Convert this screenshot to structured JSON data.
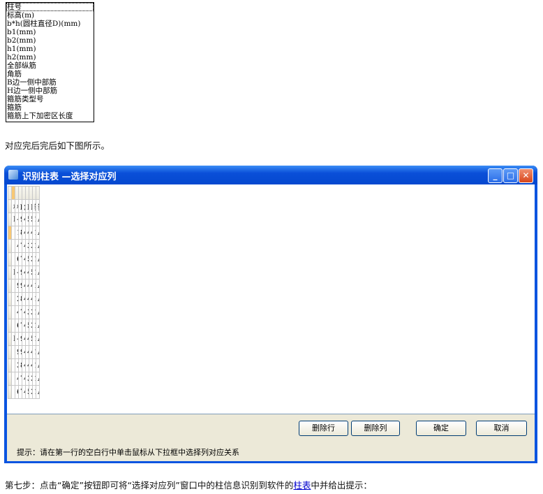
{
  "dropdown": {
    "options": [
      "柱号",
      "标高(m)",
      "b*h(圆柱直径D)(mm)",
      "b1(mm)",
      "b2(mm)",
      "h1(mm)",
      "h2(mm)",
      "全部纵筋",
      "角筋",
      "B边一侧中部筋",
      "H边一侧中部筋",
      "箍筋类型号",
      "箍筋",
      "箍筋上下加密区长度"
    ]
  },
  "intro_text": "对应完后完后如下图所示。",
  "window": {
    "title": "识别柱表 —选择对应列",
    "minimize": "_",
    "maximize": "□",
    "close": "✕"
  },
  "table": {
    "headers": [
      "柱号",
      "标高(m)",
      "b*h(圆柱直",
      "角筋",
      "B边一侧中部",
      "H边一侧中部",
      "箍筋类型号",
      "箍筋"
    ],
    "rows": [
      [
        "KZ1|KZ1",
        "-11.600~14",
        "900×900",
        "4B25",
        "5B25",
        "5B25",
        "1(7×7)",
        "A12@100"
      ],
      [
        "",
        "14.320~43.",
        "800×800",
        "4B25",
        "4B22",
        "4B22",
        "1(6×6)",
        "A10@100"
      ],
      [
        "",
        "43.150~68.",
        "700×700",
        "4B25",
        "3B22",
        "3B22",
        "1(5×5)",
        "A10@100"
      ],
      [
        "",
        "68.350~76.",
        "700×700",
        "4B28",
        "5B25",
        "3B25",
        "1(5×5)",
        "A10@100"
      ],
      [
        "KZ2",
        "-11.600~9.",
        "900×1000",
        "4B25",
        "4B25",
        "5B25",
        "1(6×7)",
        "A12@100"
      ],
      [
        "",
        "9.520~21.5",
        "900×900",
        "4B25",
        "4B25",
        "4B25",
        "1(6×6)",
        "A12@100"
      ],
      [
        "",
        "21.550~43.",
        "800×800",
        "4B25",
        "4B22",
        "4B22",
        "1(6×6)",
        "A10@100"
      ],
      [
        "",
        "43.150~68.",
        "700×700",
        "4B22",
        "3B22",
        "3B22",
        "1(5×5)",
        "A10@100"
      ],
      [
        "",
        "68.350~76.",
        "700×700",
        "4B28",
        "5B28",
        "3B25",
        "1(5×5)",
        "A10@100"
      ],
      [
        "KZ3",
        "-11.600~9.",
        "900×1000",
        "4B25",
        "4B25",
        "5B25",
        "1(6×7)",
        "A12@100"
      ],
      [
        "",
        "9.520~32.3",
        "900×900",
        "4B25",
        "4B25",
        "4B25",
        "1(6×6)",
        "A12@100"
      ],
      [
        "",
        "32.350~43.",
        "800×800",
        "4B25",
        "4B22",
        "4B22",
        "1(6×6)",
        "A10@100"
      ],
      [
        "",
        "43.150~68.",
        "700×700",
        "4B22",
        "3B22",
        "3B22",
        "1(5×5)",
        "A10@100"
      ],
      [
        "",
        "68.350~76.",
        "700×700",
        "4B28",
        "5B28",
        "3B25",
        "1(5×5)",
        "A10@100"
      ]
    ]
  },
  "buttons": {
    "delete_row": "删除行",
    "delete_col": "删除列",
    "ok": "确定",
    "cancel": "取消"
  },
  "hint": "提示：请在第一行的空白行中单击鼠标从下拉框中选择列对应关系",
  "step_text": {
    "before": "第七步：点击“确定”按钮即可将“选择对应列”窗口中的柱信息识别到软件的",
    "link": "柱表",
    "after": "中并给出提示："
  }
}
